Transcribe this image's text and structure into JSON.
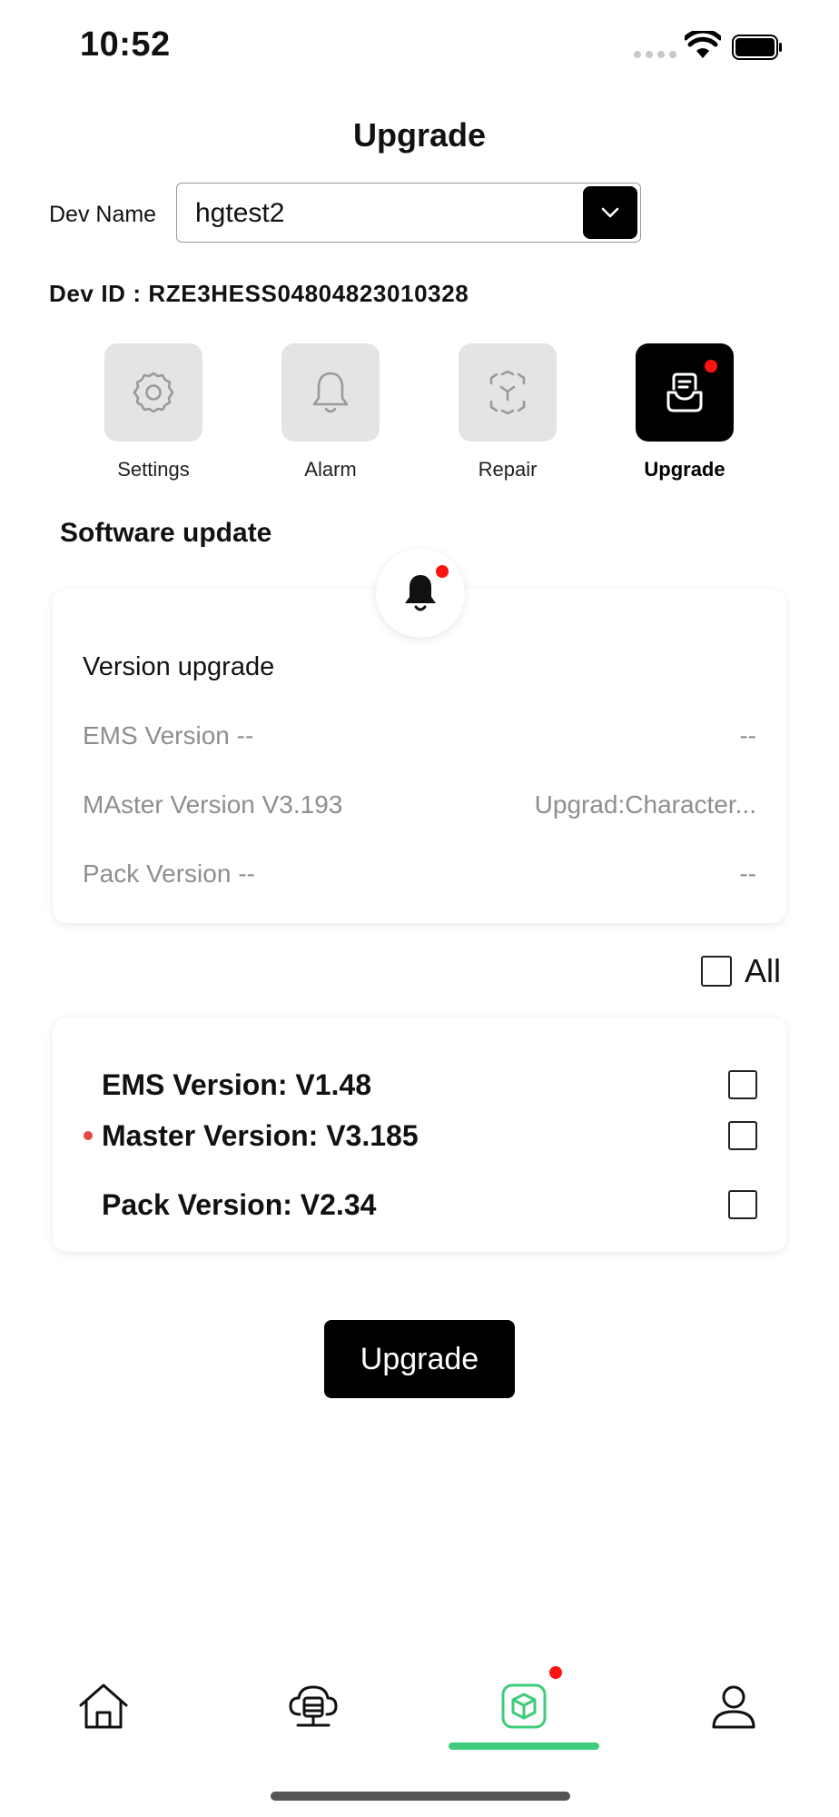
{
  "status_bar": {
    "time": "10:52"
  },
  "header": {
    "title": "Upgrade"
  },
  "device": {
    "name_label": "Dev Name",
    "name_value": "hgtest2",
    "id_text": "Dev ID : RZE3HESS04804823010328"
  },
  "tabs": [
    {
      "label": "Settings",
      "icon": "gear-icon",
      "active": false
    },
    {
      "label": "Alarm",
      "icon": "bell-icon",
      "active": false
    },
    {
      "label": "Repair",
      "icon": "repair-icon",
      "active": false
    },
    {
      "label": "Upgrade",
      "icon": "upgrade-icon",
      "active": true,
      "badge": true
    }
  ],
  "software_update": {
    "title": "Software update",
    "version_upgrade_label": "Version upgrade",
    "rows": [
      {
        "label": "EMS Version --",
        "value": "--"
      },
      {
        "label": "MAster Version V3.193",
        "value": "Upgrad:Character..."
      },
      {
        "label": "Pack Version  --",
        "value": "--"
      }
    ]
  },
  "select_all": {
    "label": "All",
    "checked": false
  },
  "options": [
    {
      "label": "EMS Version: V1.48",
      "checked": false,
      "marked": false
    },
    {
      "label": "Master Version: V3.185",
      "checked": false,
      "marked": true
    },
    {
      "label": "Pack Version: V2.34",
      "checked": false,
      "marked": false
    }
  ],
  "upgrade_button": {
    "label": "Upgrade"
  },
  "bottom_nav": [
    {
      "icon": "home-icon",
      "active": false
    },
    {
      "icon": "device-icon",
      "active": false
    },
    {
      "icon": "upgrade-box-icon",
      "active": true,
      "badge": true
    },
    {
      "icon": "user-icon",
      "active": false
    }
  ],
  "colors": {
    "accent_green": "#3dcc7a",
    "badge_red": "#ff1212",
    "muted_text": "#8e8e8e"
  }
}
